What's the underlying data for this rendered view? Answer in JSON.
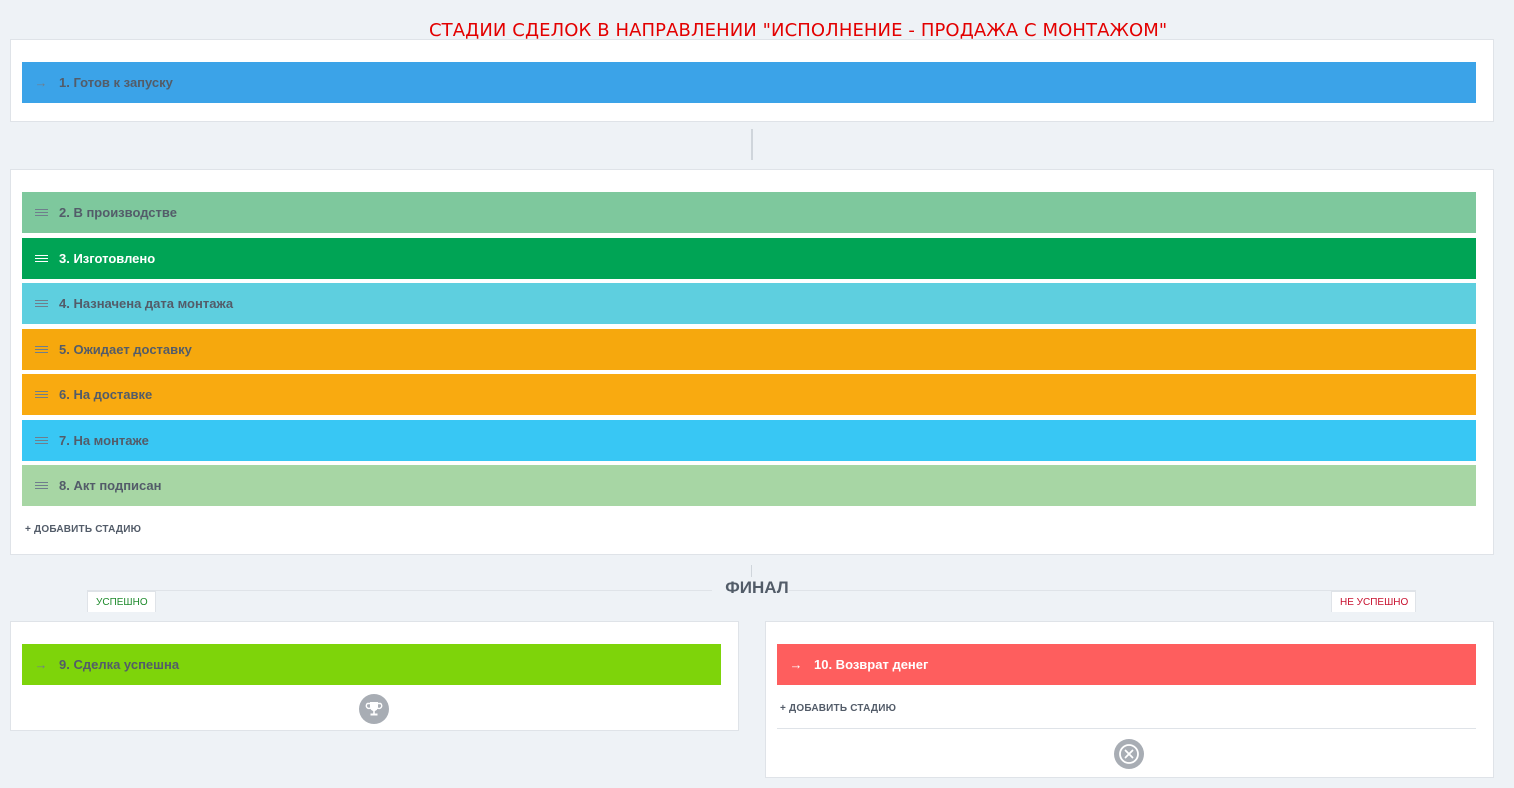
{
  "annotation": "СТАДИИ СДЕЛОК В НАПРАВЛЕНИИ \"ИСПОЛНЕНИЕ - ПРОДАЖА С МОНТАЖОМ\"",
  "first_stage": {
    "label": "1. Готов к запуску",
    "color": "#3ba3e8",
    "icon": "arrow-right-icon"
  },
  "process_stages": [
    {
      "label": "2. В производстве",
      "color": "#7ec89d",
      "icon": "drag-handle-icon"
    },
    {
      "label": "3. Изготовлено",
      "color": "#00a455",
      "icon": "drag-handle-icon"
    },
    {
      "label": "4. Назначена дата монтажа",
      "color": "#5ecfdf",
      "icon": "drag-handle-icon"
    },
    {
      "label": "5. Ожидает доставку",
      "color": "#f6a80d",
      "icon": "drag-handle-icon"
    },
    {
      "label": "6. На доставке",
      "color": "#f9aa10",
      "icon": "drag-handle-icon"
    },
    {
      "label": "7. На монтаже",
      "color": "#38c7f4",
      "icon": "drag-handle-icon"
    },
    {
      "label": "8. Акт подписан",
      "color": "#a7d6a4",
      "icon": "drag-handle-icon"
    }
  ],
  "add_stage_label": "+ ДОБАВИТЬ СТАДИЮ",
  "final": {
    "title": "ФИНАЛ",
    "success_tab": "УСПЕШНО",
    "fail_tab": "НЕ УСПЕШНО",
    "success_color": "#1e8b2c",
    "fail_color": "#c8102e",
    "success_stage": {
      "label": "9. Сделка успешна",
      "color": "#7ed40a",
      "icon": "arrow-right-icon"
    },
    "fail_stage": {
      "label": "10. Возврат денег",
      "color": "#fe5e5e",
      "icon": "arrow-right-icon"
    },
    "add_stage_label": "+ ДОБАВИТЬ СТАДИЮ",
    "success_icon": "trophy-icon",
    "fail_icon": "close-circle-icon"
  }
}
